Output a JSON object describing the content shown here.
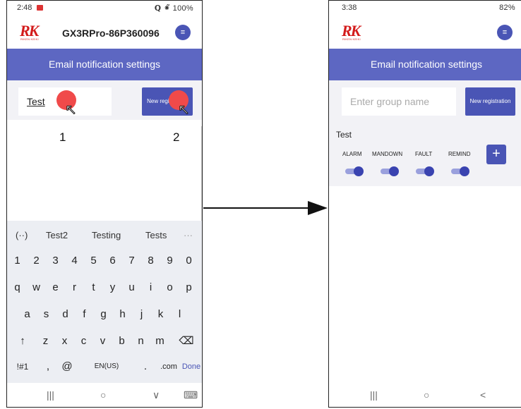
{
  "left": {
    "status": {
      "time": "2:48",
      "right": "⁕̃ 100%"
    },
    "device": "GX3RPro-86P360096",
    "logo": {
      "mark": "RK",
      "sub": "RIKEN KEIKI"
    },
    "menu_icon": "≡",
    "header": "Email notification settings",
    "group_input_value": "Test",
    "new_reg_label": "New registration",
    "step1": "1",
    "step2": "2",
    "suggestions": {
      "icon": "(··)",
      "s1": "Test2",
      "s2": "Testing",
      "s3": "Tests",
      "more": "···"
    },
    "row1": [
      "1",
      "2",
      "3",
      "4",
      "5",
      "6",
      "7",
      "8",
      "9",
      "0"
    ],
    "row2": [
      "q",
      "w",
      "e",
      "r",
      "t",
      "y",
      "u",
      "i",
      "o",
      "p"
    ],
    "row3": [
      "a",
      "s",
      "d",
      "f",
      "g",
      "h",
      "j",
      "k",
      "l"
    ],
    "row4": [
      "z",
      "x",
      "c",
      "v",
      "b",
      "n",
      "m"
    ],
    "shift": "↑",
    "backspace": "⌫",
    "row5": {
      "sym": "!#1",
      "comma": ",",
      "at": "@",
      "lang": "EN(US)",
      "dot": ".",
      "com": ".com",
      "done": "Done"
    },
    "nav": {
      "recent": "|||",
      "home": "○",
      "back": "∨",
      "kbd": "⌨"
    }
  },
  "right": {
    "status": {
      "time": "3:38",
      "right": "82%"
    },
    "logo": {
      "mark": "RK",
      "sub": "RIKEN KEIKI"
    },
    "menu_icon": "≡",
    "header": "Email notification settings",
    "group_input_placeholder": "Enter group name",
    "new_reg_label": "New registration",
    "group": {
      "name": "Test",
      "labels": [
        "ALARM",
        "MANDOWN",
        "FAULT",
        "REMIND"
      ],
      "toggles": [
        true,
        true,
        true,
        true
      ]
    },
    "plus": "+",
    "nav": {
      "recent": "|||",
      "home": "○",
      "back": "<"
    }
  },
  "colors": {
    "accent": "#4a55b5",
    "header": "#5d67c2",
    "tap": "#f04a4a",
    "logo": "#d31b1b"
  }
}
